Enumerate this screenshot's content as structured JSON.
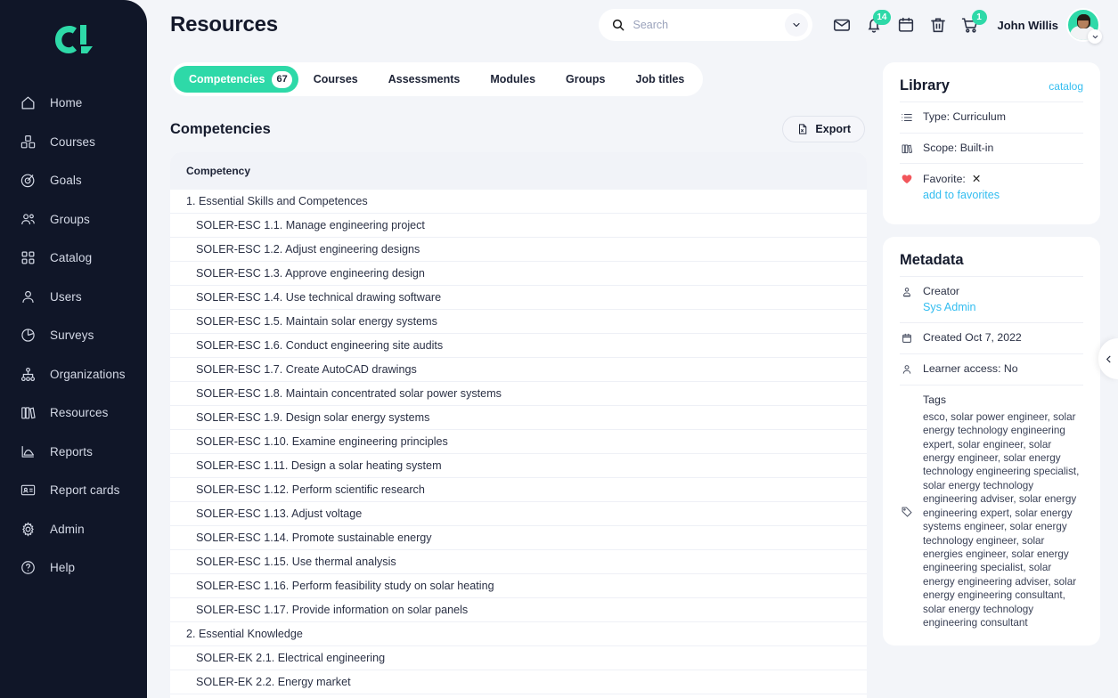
{
  "brand": {
    "logo_name": "cl-logo",
    "accent": "#2ed9a8",
    "sidebar_bg": "#101628"
  },
  "sidebar": {
    "items": [
      {
        "label": "Home",
        "icon": "home-icon"
      },
      {
        "label": "Courses",
        "icon": "courses-icon"
      },
      {
        "label": "Goals",
        "icon": "goals-icon"
      },
      {
        "label": "Groups",
        "icon": "groups-icon"
      },
      {
        "label": "Catalog",
        "icon": "catalog-icon"
      },
      {
        "label": "Users",
        "icon": "users-icon"
      },
      {
        "label": "Surveys",
        "icon": "surveys-icon"
      },
      {
        "label": "Organizations",
        "icon": "organizations-icon"
      },
      {
        "label": "Resources",
        "icon": "resources-icon"
      },
      {
        "label": "Reports",
        "icon": "reports-icon"
      },
      {
        "label": "Report cards",
        "icon": "report-cards-icon"
      }
    ],
    "bottom_items": [
      {
        "label": "Admin",
        "icon": "gear-icon"
      },
      {
        "label": "Help",
        "icon": "help-icon"
      }
    ]
  },
  "header": {
    "title": "Resources",
    "search": {
      "placeholder": "Search",
      "value": ""
    },
    "icons": [
      {
        "name": "mail-icon",
        "badge": ""
      },
      {
        "name": "bell-icon",
        "badge": "14"
      },
      {
        "name": "calendar-icon",
        "badge": ""
      },
      {
        "name": "trash-icon",
        "badge": ""
      },
      {
        "name": "cart-icon",
        "badge": "1"
      }
    ],
    "user_name": "John Willis"
  },
  "tabs": [
    {
      "label": "Competencies",
      "count": "67",
      "active": true
    },
    {
      "label": "Courses",
      "count": "",
      "active": false
    },
    {
      "label": "Assessments",
      "count": "",
      "active": false
    },
    {
      "label": "Modules",
      "count": "",
      "active": false
    },
    {
      "label": "Groups",
      "count": "",
      "active": false
    },
    {
      "label": "Job titles",
      "count": "",
      "active": false
    }
  ],
  "section": {
    "title": "Competencies",
    "export_label": "Export"
  },
  "table": {
    "column_header": "Competency",
    "rows": [
      {
        "text": "1. Essential Skills and Competences",
        "level": "group"
      },
      {
        "text": "SOLER-ESC 1.1. Manage engineering project",
        "level": "child"
      },
      {
        "text": "SOLER-ESC 1.2. Adjust engineering designs",
        "level": "child"
      },
      {
        "text": "SOLER-ESC 1.3. Approve engineering design",
        "level": "child"
      },
      {
        "text": "SOLER-ESC 1.4. Use technical drawing software",
        "level": "child"
      },
      {
        "text": "SOLER-ESC 1.5. Maintain solar energy systems",
        "level": "child"
      },
      {
        "text": "SOLER-ESC 1.6. Conduct engineering site audits",
        "level": "child"
      },
      {
        "text": "SOLER-ESC 1.7. Create AutoCAD drawings",
        "level": "child"
      },
      {
        "text": "SOLER-ESC 1.8. Maintain concentrated solar power systems",
        "level": "child"
      },
      {
        "text": "SOLER-ESC 1.9. Design solar energy systems",
        "level": "child"
      },
      {
        "text": "SOLER-ESC 1.10. Examine engineering principles",
        "level": "child"
      },
      {
        "text": "SOLER-ESC 1.11. Design a solar heating system",
        "level": "child"
      },
      {
        "text": "SOLER-ESC 1.12. Perform scientific research",
        "level": "child"
      },
      {
        "text": "SOLER-ESC 1.13. Adjust voltage",
        "level": "child"
      },
      {
        "text": "SOLER-ESC 1.14. Promote sustainable energy",
        "level": "child"
      },
      {
        "text": "SOLER-ESC 1.15. Use thermal analysis",
        "level": "child"
      },
      {
        "text": "SOLER-ESC 1.16. Perform feasibility study on solar heating",
        "level": "child"
      },
      {
        "text": "SOLER-ESC 1.17. Provide information on solar panels",
        "level": "child"
      },
      {
        "text": "2. Essential Knowledge",
        "level": "group"
      },
      {
        "text": "SOLER-EK 2.1. Electrical engineering",
        "level": "child"
      },
      {
        "text": "SOLER-EK 2.2. Energy market",
        "level": "child"
      }
    ]
  },
  "library": {
    "title": "Library",
    "link": "catalog",
    "type": "Type: Curriculum",
    "scope": "Scope: Built-in",
    "favorite_label": "Favorite:",
    "favorite_value": "✕",
    "add_favorites": "add to favorites"
  },
  "metadata": {
    "title": "Metadata",
    "creator_label": "Creator",
    "creator_value": "Sys Admin",
    "created_label": "Created",
    "created_value": "Oct 7, 2022",
    "learner_access": "Learner access: No",
    "tags_label": "Tags",
    "tags_value": "esco, solar power engineer, solar energy technology engineering expert, solar engineer, solar energy engineer, solar energy technology engineering specialist, solar energy technology engineering adviser, solar energy engineering expert, solar energy systems engineer, solar energy technology engineer, solar energies engineer, solar energy engineering specialist, solar energy engineering adviser, solar energy engineering consultant, solar energy technology engineering consultant"
  },
  "collapse_handle": {
    "icon": "chevron-left-icon"
  }
}
